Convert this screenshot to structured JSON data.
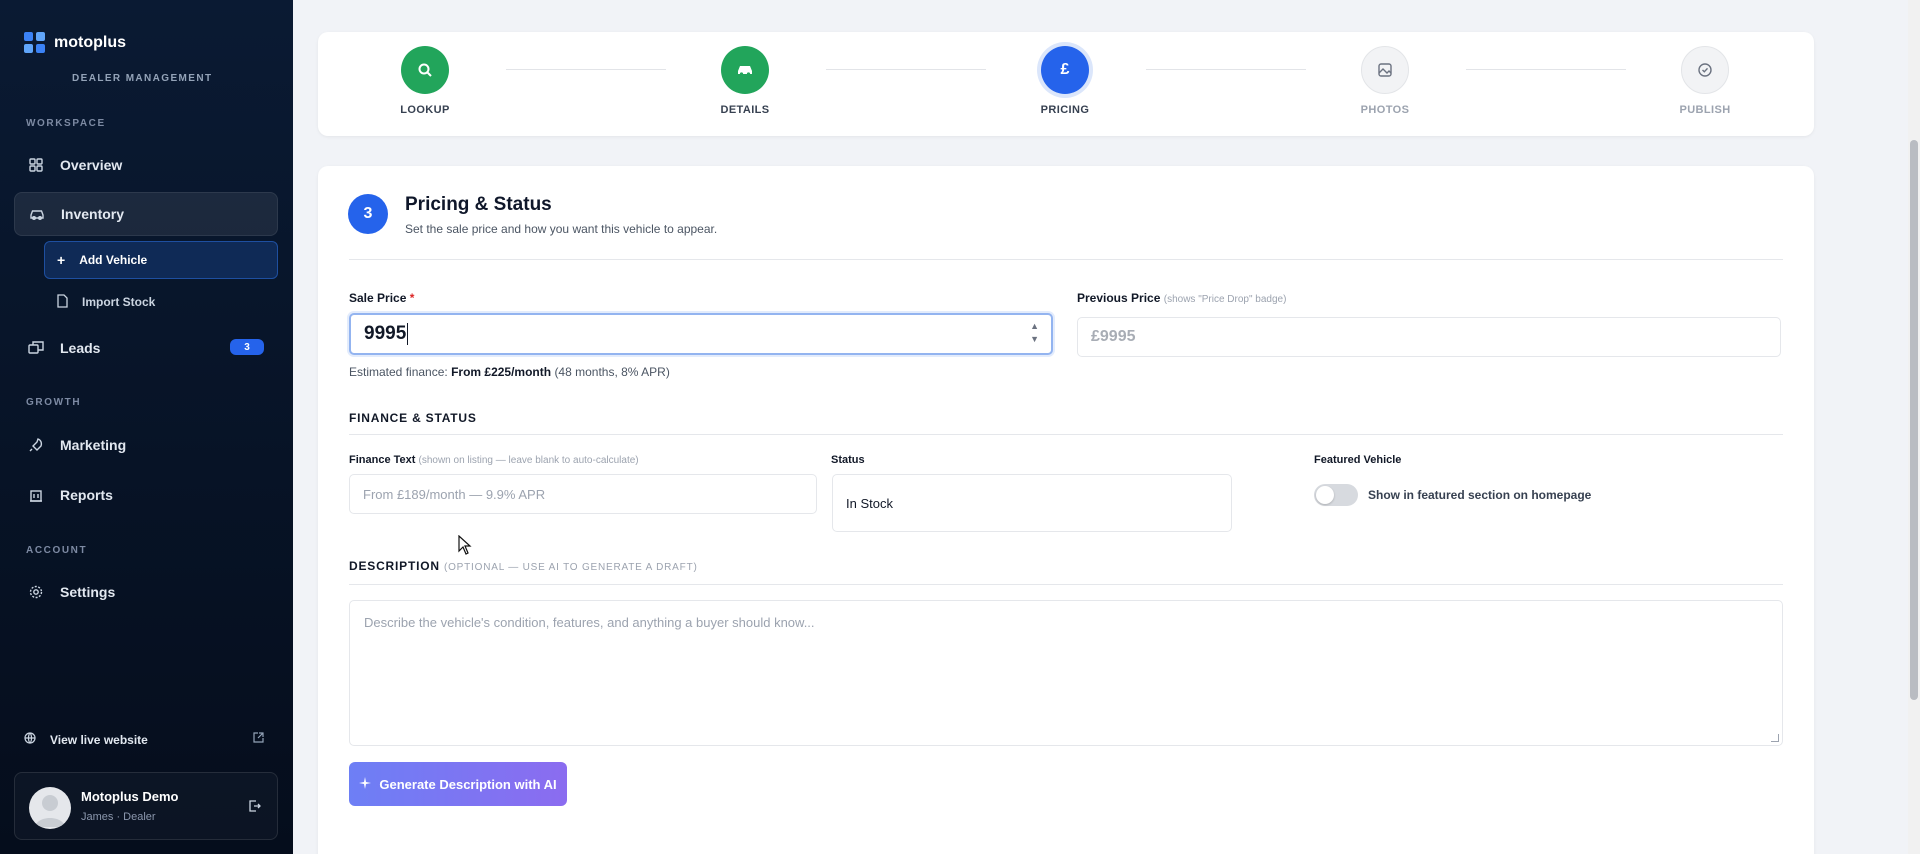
{
  "brand": {
    "name": "motoplus",
    "subtitle": "DEALER MANAGEMENT"
  },
  "sidebar": {
    "sections": {
      "workspace": "WORKSPACE",
      "growth": "GROWTH",
      "account": "ACCOUNT"
    },
    "items": {
      "overview": "Overview",
      "inventory": "Inventory",
      "add_vehicle": "Add Vehicle",
      "import_stock": "Import Stock",
      "leads": "Leads",
      "leads_count": "3",
      "marketing": "Marketing",
      "reports": "Reports",
      "settings": "Settings"
    },
    "live_site": "View live website",
    "user": {
      "name": "Motoplus Demo",
      "role": "James · Dealer"
    }
  },
  "stepper": {
    "steps": [
      {
        "label": "LOOKUP",
        "state": "done",
        "icon": "search-icon"
      },
      {
        "label": "DETAILS",
        "state": "done",
        "icon": "car-icon"
      },
      {
        "label": "PRICING",
        "state": "current",
        "icon": "pound-icon",
        "symbol": "£"
      },
      {
        "label": "PHOTOS",
        "state": "todo",
        "icon": "image-icon"
      },
      {
        "label": "PUBLISH",
        "state": "todo",
        "icon": "check-circle-icon"
      }
    ]
  },
  "card": {
    "step_number": "3",
    "title": "Pricing & Status",
    "subtitle": "Set the sale price and how you want this vehicle to appear.",
    "sale_price": {
      "label": "Sale Price",
      "required_mark": "*",
      "value": "9995",
      "hint_prefix": "Estimated finance:",
      "hint_value": "From £225/month",
      "hint_suffix": "(48 months, 8% APR)"
    },
    "previous_price": {
      "label": "Previous Price",
      "note": "(shows \"Price Drop\" badge)",
      "placeholder": "£9995"
    },
    "finance_status": {
      "section_title": "FINANCE & STATUS",
      "finance_text_label": "Finance Text",
      "finance_text_note": "(shown on listing — leave blank to auto-calculate)",
      "finance_text_placeholder": "From £189/month — 9.9% APR",
      "status_label": "Status",
      "status_value": "In Stock",
      "featured_label": "Featured Vehicle",
      "featured_toggle_label": "Show in featured section on homepage",
      "featured_on": false
    },
    "description": {
      "section_title": "DESCRIPTION",
      "section_note": "(OPTIONAL — USE AI TO GENERATE A DRAFT)",
      "placeholder": "Describe the vehicle's condition, features, and anything a buyer should know..."
    },
    "ai_button": "Generate Description with AI"
  },
  "colors": {
    "accent": "#2563eb",
    "success": "#22a55b",
    "sidebar_bg": "#0a1a33",
    "ai_gradient_start": "#6d7ff5",
    "ai_gradient_end": "#8b6cf0"
  }
}
